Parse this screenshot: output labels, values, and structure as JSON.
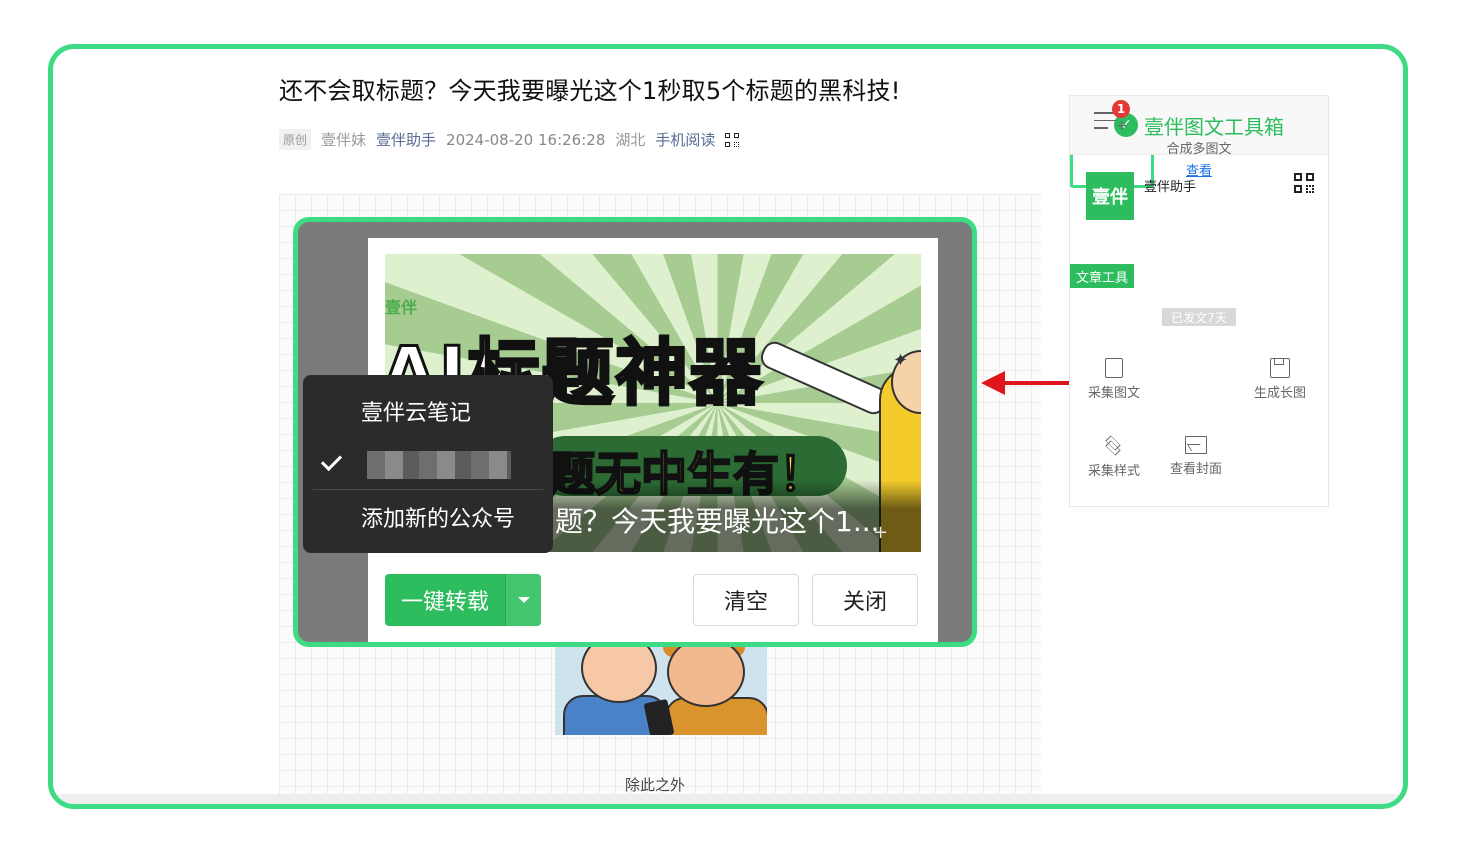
{
  "article": {
    "title": "还不会取标题？今天我要曝光这个1秒取5个标题的黑科技!",
    "original_tag": "原创",
    "author": "壹伴妹",
    "account": "壹伴助手",
    "date": "2024-08-20 16:26:28",
    "region": "湖北",
    "mobile_read": "手机阅读",
    "caption": "除此之外"
  },
  "dialog": {
    "cover": {
      "brand": "壹伴",
      "big_title": "AI标题神器",
      "sub_title": "题无中生有！",
      "caption": "题？今天我要曝光这个1..."
    },
    "repost_button": "一键转载",
    "clear_button": "清空",
    "close_button": "关闭"
  },
  "popup_menu": {
    "item_notes": "壹伴云笔记",
    "item_add": "添加新的公众号"
  },
  "toolbox": {
    "title": "壹伴图文工具箱",
    "account_avatar": "壹伴",
    "account_name": "壹伴助手",
    "section_label": "文章工具",
    "days_badge": "已发文7天",
    "tools": {
      "collect": "采集图文",
      "merge": "合成多图文",
      "merge_badge": "1",
      "merge_view": "查看",
      "long_image": "生成长图",
      "style": "采集样式",
      "cover": "查看封面"
    }
  },
  "colors": {
    "accent": "#3ddc84",
    "brand_green": "#2ebd5e",
    "arrow_red": "#e0141b",
    "link_blue": "#576b95"
  }
}
